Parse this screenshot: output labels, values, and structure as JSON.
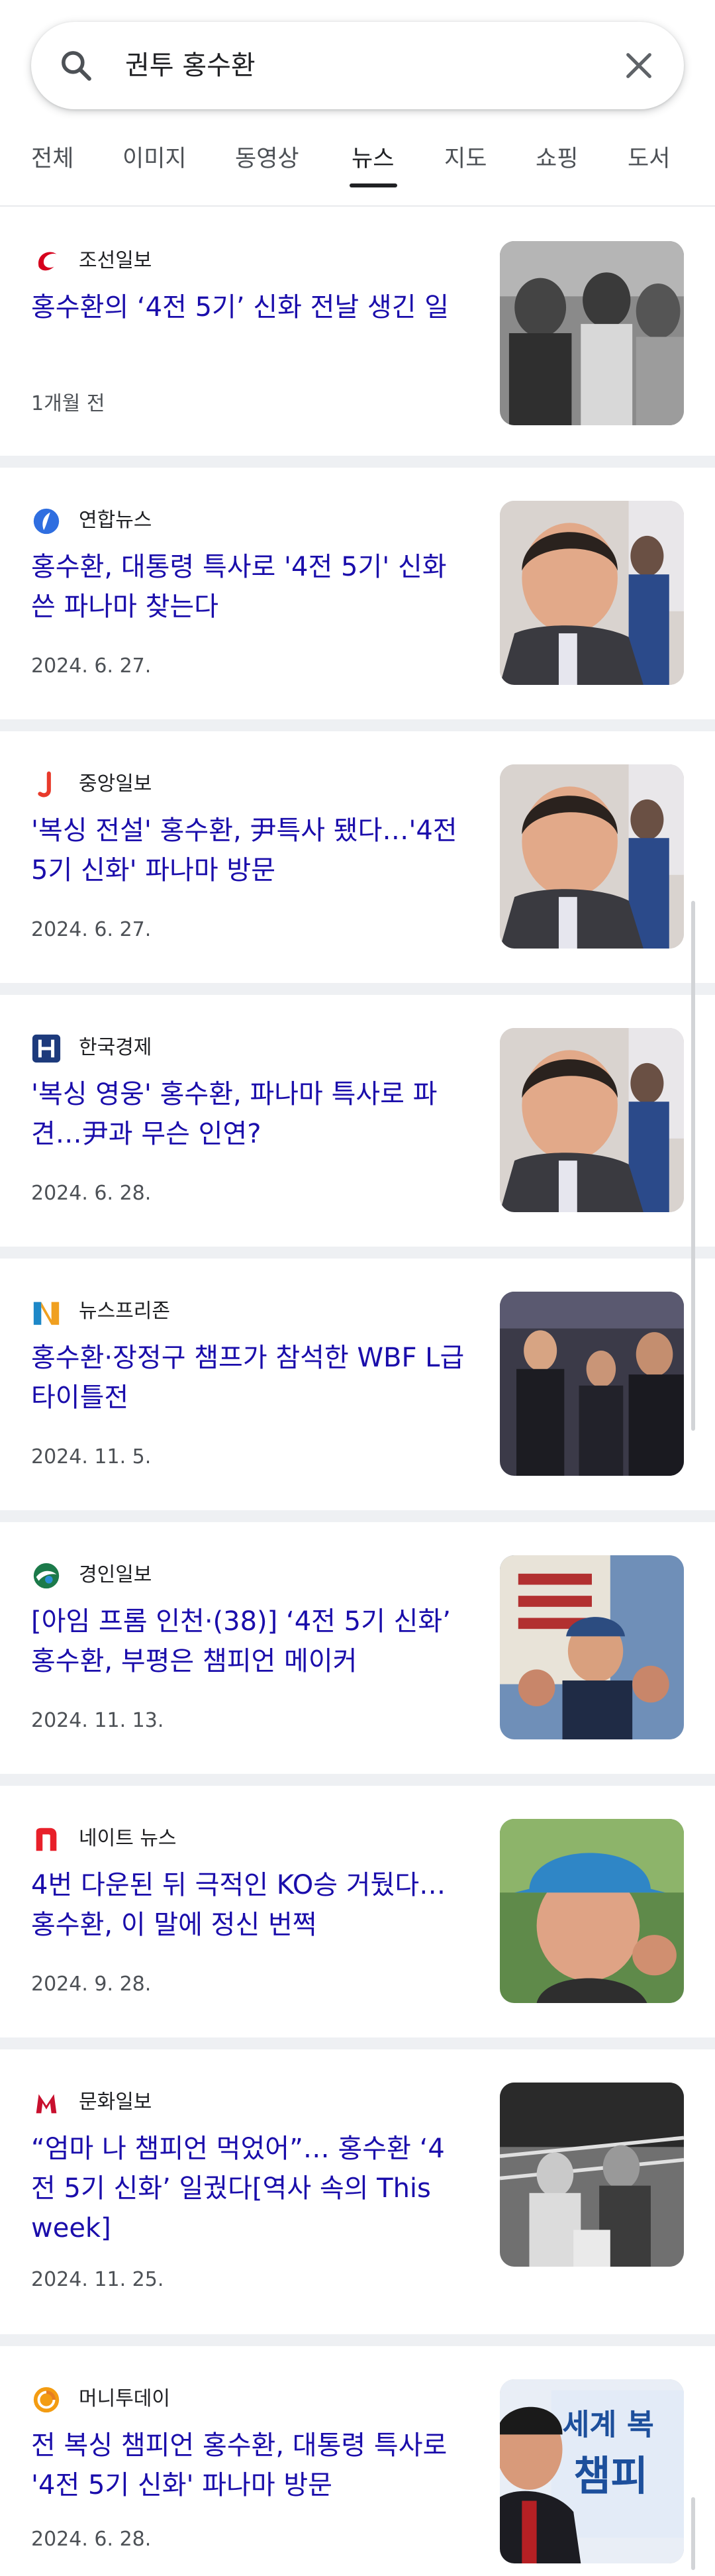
{
  "search": {
    "query": "권투 홍수환"
  },
  "tabs": [
    "전체",
    "이미지",
    "동영상",
    "뉴스",
    "지도",
    "쇼핑",
    "도서"
  ],
  "active_tab": "뉴스",
  "articles": [
    {
      "source": "조선일보",
      "logo_icon": "chosun-logo-icon",
      "logo_color": "#d6001c",
      "title": "홍수환의 ‘4전 5기’ 신화 전날 생긴 일",
      "date": "1개월 전",
      "thumb_icon": "boxing-vintage-photo-thumbnail"
    },
    {
      "source": "연합뉴스",
      "logo_icon": "yonhap-logo-icon",
      "logo_color": "#2f6ee0",
      "title": "홍수환, 대통령 특사로 '4전 5기' 신화 쓴 파나마 찾는다",
      "date": "2024. 6. 27.",
      "thumb_icon": "smiling-man-portrait-thumbnail"
    },
    {
      "source": "중앙일보",
      "logo_icon": "joongang-logo-icon",
      "logo_color": "#e83a2b",
      "title": "'복싱 전설' 홍수환, 尹특사 됐다…'4전 5기 신화' 파나마 방문",
      "date": "2024. 6. 27.",
      "thumb_icon": "smiling-man-portrait-thumbnail"
    },
    {
      "source": "한국경제",
      "logo_icon": "hankyung-logo-icon",
      "logo_color": "#1d3a7c",
      "title": "'복싱 영웅' 홍수환, 파나마 특사로 파견…尹과 무슨 인연?",
      "date": "2024. 6. 28.",
      "thumb_icon": "smiling-man-portrait-thumbnail"
    },
    {
      "source": "뉴스프리존",
      "logo_icon": "newsfreezone-logo-icon",
      "logo_color": "#f0a020",
      "title": "홍수환·장정구 챔프가 참석한 WBF L급 타이틀전",
      "date": "2024. 11. 5.",
      "thumb_icon": "three-men-ring-thumbnail"
    },
    {
      "source": "경인일보",
      "logo_icon": "kyeongin-logo-icon",
      "logo_color": "#1c7a4a",
      "title": "[아임 프롬 인천·(38)] ‘4전 5기 신화’ 홍수환, 부평은 챔피언 메이커",
      "date": "2024. 11. 13.",
      "thumb_icon": "man-boxing-pose-thumbnail"
    },
    {
      "source": "네이트 뉴스",
      "logo_icon": "nate-logo-icon",
      "logo_color": "#e8202a",
      "title": "4번 다운된 뒤 극적인 KO승 거뒀다… 홍수환, 이 말에 정신 번쩍",
      "date": "2024. 9. 28.",
      "thumb_icon": "man-with-hat-thumbnail"
    },
    {
      "source": "문화일보",
      "logo_icon": "munhwa-logo-icon",
      "logo_color": "#c8102e",
      "title": "“엄마 나 챔피언 먹었어”… 홍수환 ‘4전 5기 신화’ 일궜다[역사 속의 This week]",
      "date": "2024. 11. 25.",
      "thumb_icon": "boxing-match-vintage-thumbnail"
    },
    {
      "source": "머니투데이",
      "logo_icon": "moneytoday-logo-icon",
      "logo_color": "#f39c12",
      "title": "전 복싱 챔피언 홍수환, 대통령 특사로 '4전 5기 신화' 파나마 방문",
      "date": "2024. 6. 28.",
      "thumb_icon": "man-with-banner-thumbnail",
      "thumb_text": [
        "세계 복",
        "챔피"
      ]
    }
  ],
  "colors": {
    "headline": "#1a0dab",
    "meta": "#4d5156",
    "separator": "#eef0f3"
  }
}
